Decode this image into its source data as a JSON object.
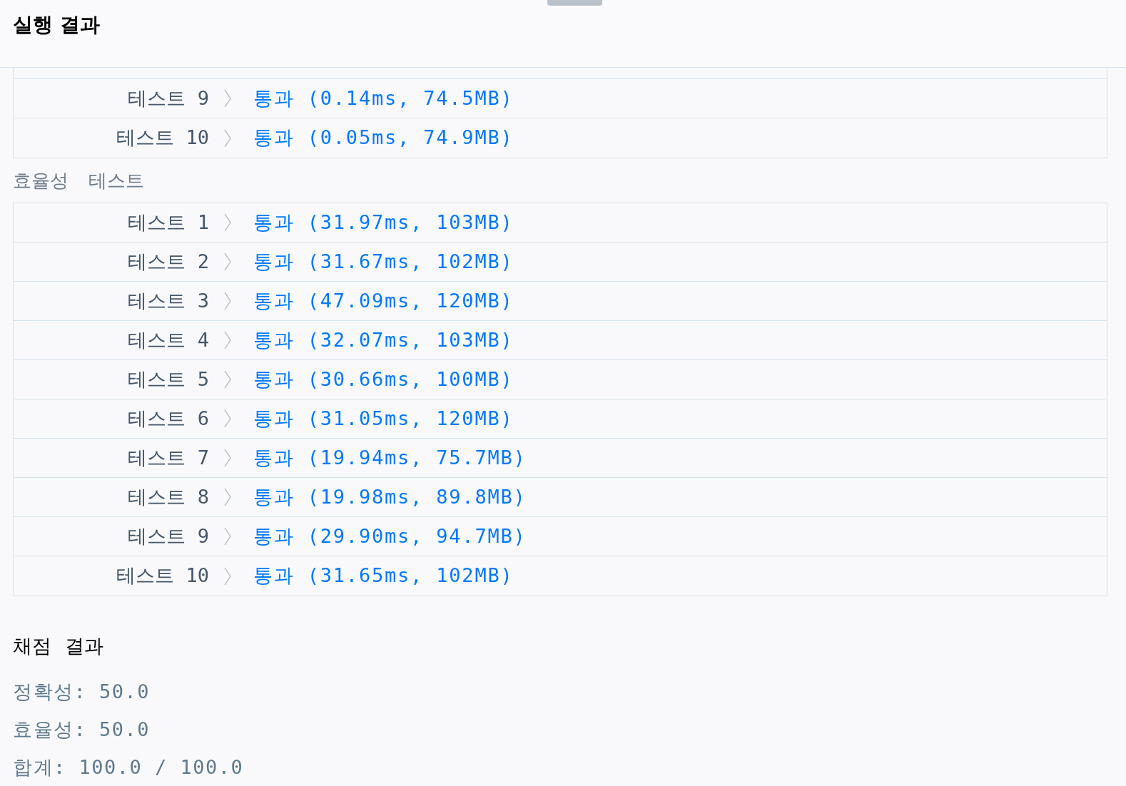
{
  "header": {
    "title": "실행 결과"
  },
  "tables": [
    {
      "rows": [
        {
          "label": "테스트 9",
          "status": "통과",
          "result": "(0.14ms, 74.5MB)"
        },
        {
          "label": "테스트 10",
          "status": "통과",
          "result": "(0.05ms, 74.9MB)"
        }
      ]
    },
    {
      "title": "효율성 테스트",
      "rows": [
        {
          "label": "테스트 1",
          "status": "통과",
          "result": "(31.97ms, 103MB)"
        },
        {
          "label": "테스트 2",
          "status": "통과",
          "result": "(31.67ms, 102MB)"
        },
        {
          "label": "테스트 3",
          "status": "통과",
          "result": "(47.09ms, 120MB)"
        },
        {
          "label": "테스트 4",
          "status": "통과",
          "result": "(32.07ms, 103MB)"
        },
        {
          "label": "테스트 5",
          "status": "통과",
          "result": "(30.66ms, 100MB)"
        },
        {
          "label": "테스트 6",
          "status": "통과",
          "result": "(31.05ms, 120MB)"
        },
        {
          "label": "테스트 7",
          "status": "통과",
          "result": "(19.94ms, 75.7MB)"
        },
        {
          "label": "테스트 8",
          "status": "통과",
          "result": "(19.98ms, 89.8MB)"
        },
        {
          "label": "테스트 9",
          "status": "통과",
          "result": "(29.90ms, 94.7MB)"
        },
        {
          "label": "테스트 10",
          "status": "통과",
          "result": "(31.65ms, 102MB)"
        }
      ]
    }
  ],
  "score": {
    "title": "채점 결과",
    "lines": [
      "정확성: 50.0",
      "효율성: 50.0",
      "합계: 100.0 / 100.0"
    ]
  }
}
